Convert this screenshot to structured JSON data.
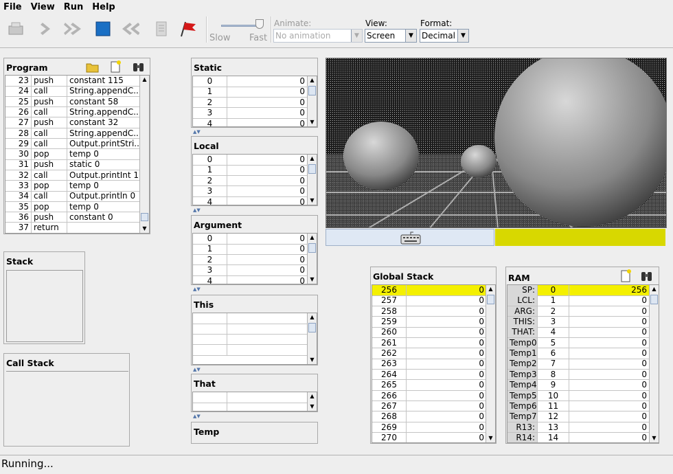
{
  "menu": {
    "file": "File",
    "view": "View",
    "run": "Run",
    "help": "Help"
  },
  "toolbar": {
    "slow": "Slow",
    "fast": "Fast",
    "animate_label": "Animate:",
    "animate_value": "No animation",
    "view_label": "View:",
    "view_value": "Screen",
    "format_label": "Format:",
    "format_value": "Decimal"
  },
  "program": {
    "title": "Program",
    "rows": [
      {
        "n": "23",
        "op": "push",
        "arg": "constant 115"
      },
      {
        "n": "24",
        "op": "call",
        "arg": "String.appendC..."
      },
      {
        "n": "25",
        "op": "push",
        "arg": "constant 58"
      },
      {
        "n": "26",
        "op": "call",
        "arg": "String.appendC..."
      },
      {
        "n": "27",
        "op": "push",
        "arg": "constant 32"
      },
      {
        "n": "28",
        "op": "call",
        "arg": "String.appendC..."
      },
      {
        "n": "29",
        "op": "call",
        "arg": "Output.printStri..."
      },
      {
        "n": "30",
        "op": "pop",
        "arg": "temp 0"
      },
      {
        "n": "31",
        "op": "push",
        "arg": "static 0"
      },
      {
        "n": "32",
        "op": "call",
        "arg": "Output.printInt 1"
      },
      {
        "n": "33",
        "op": "pop",
        "arg": "temp 0"
      },
      {
        "n": "34",
        "op": "call",
        "arg": "Output.println 0"
      },
      {
        "n": "35",
        "op": "pop",
        "arg": "temp 0"
      },
      {
        "n": "36",
        "op": "push",
        "arg": "constant 0"
      },
      {
        "n": "37",
        "op": "return",
        "arg": ""
      }
    ]
  },
  "stack": {
    "title": "Stack"
  },
  "call_stack": {
    "title": "Call Stack"
  },
  "segments": {
    "static": {
      "title": "Static",
      "rows": [
        {
          "i": "0",
          "v": "0"
        },
        {
          "i": "1",
          "v": "0"
        },
        {
          "i": "2",
          "v": "0"
        },
        {
          "i": "3",
          "v": "0"
        },
        {
          "i": "4",
          "v": "0"
        }
      ]
    },
    "local": {
      "title": "Local",
      "rows": [
        {
          "i": "0",
          "v": "0"
        },
        {
          "i": "1",
          "v": "0"
        },
        {
          "i": "2",
          "v": "0"
        },
        {
          "i": "3",
          "v": "0"
        },
        {
          "i": "4",
          "v": "0"
        }
      ]
    },
    "argument": {
      "title": "Argument",
      "rows": [
        {
          "i": "0",
          "v": "0"
        },
        {
          "i": "1",
          "v": "0"
        },
        {
          "i": "2",
          "v": "0"
        },
        {
          "i": "3",
          "v": "0"
        },
        {
          "i": "4",
          "v": "0"
        }
      ]
    },
    "this": {
      "title": "This"
    },
    "that": {
      "title": "That"
    },
    "temp": {
      "title": "Temp"
    }
  },
  "global_stack": {
    "title": "Global Stack",
    "rows": [
      {
        "a": "256",
        "v": "0"
      },
      {
        "a": "257",
        "v": "0"
      },
      {
        "a": "258",
        "v": "0"
      },
      {
        "a": "259",
        "v": "0"
      },
      {
        "a": "260",
        "v": "0"
      },
      {
        "a": "261",
        "v": "0"
      },
      {
        "a": "262",
        "v": "0"
      },
      {
        "a": "263",
        "v": "0"
      },
      {
        "a": "264",
        "v": "0"
      },
      {
        "a": "265",
        "v": "0"
      },
      {
        "a": "266",
        "v": "0"
      },
      {
        "a": "267",
        "v": "0"
      },
      {
        "a": "268",
        "v": "0"
      },
      {
        "a": "269",
        "v": "0"
      },
      {
        "a": "270",
        "v": "0"
      }
    ]
  },
  "ram": {
    "title": "RAM",
    "rows": [
      {
        "l": "SP:",
        "a": "0",
        "v": "256"
      },
      {
        "l": "LCL:",
        "a": "1",
        "v": "0"
      },
      {
        "l": "ARG:",
        "a": "2",
        "v": "0"
      },
      {
        "l": "THIS:",
        "a": "3",
        "v": "0"
      },
      {
        "l": "THAT:",
        "a": "4",
        "v": "0"
      },
      {
        "l": "Temp0:",
        "a": "5",
        "v": "0"
      },
      {
        "l": "Temp1:",
        "a": "6",
        "v": "0"
      },
      {
        "l": "Temp2:",
        "a": "7",
        "v": "0"
      },
      {
        "l": "Temp3:",
        "a": "8",
        "v": "0"
      },
      {
        "l": "Temp4:",
        "a": "9",
        "v": "0"
      },
      {
        "l": "Temp5:",
        "a": "10",
        "v": "0"
      },
      {
        "l": "Temp6:",
        "a": "11",
        "v": "0"
      },
      {
        "l": "Temp7:",
        "a": "12",
        "v": "0"
      },
      {
        "l": "R13:",
        "a": "13",
        "v": "0"
      },
      {
        "l": "R14:",
        "a": "14",
        "v": "0"
      }
    ]
  },
  "status": "Running...",
  "colors": {
    "highlight": "#f4f000",
    "keyboard_bar": "#dfe8f4",
    "screen_bg": "#222222"
  }
}
